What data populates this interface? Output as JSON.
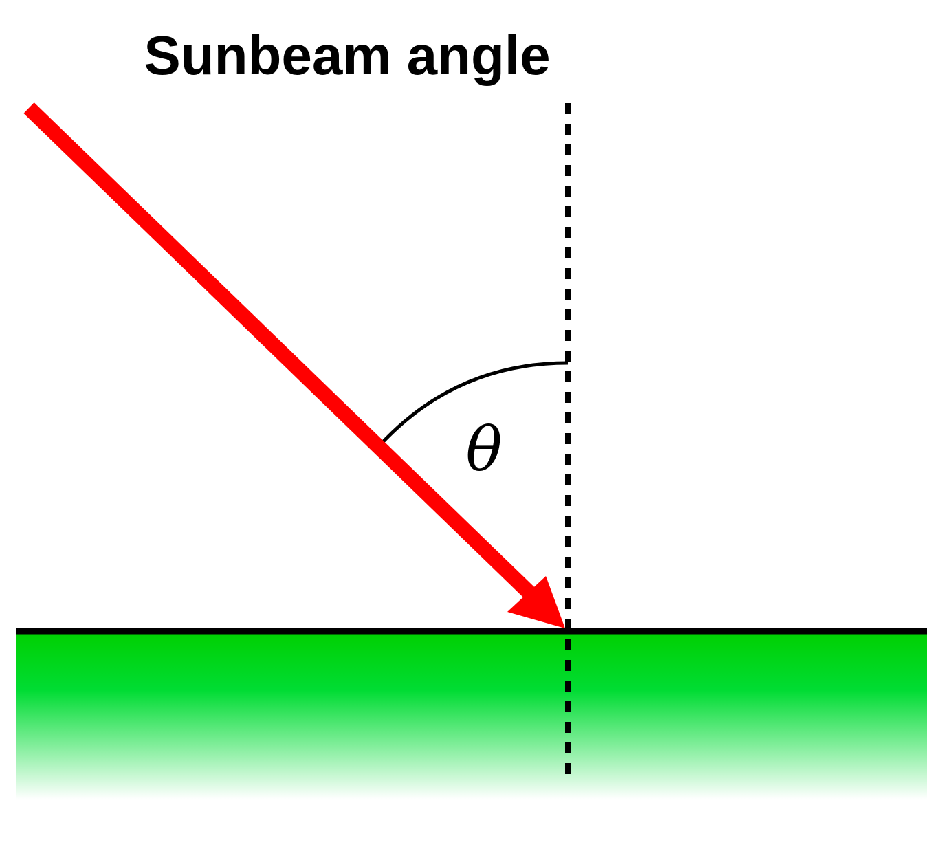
{
  "diagram": {
    "title": "Sunbeam angle",
    "angle_label": "θ",
    "colors": {
      "sunbeam": "#ff0000",
      "ground": "#00d000",
      "ground_fade": "#ffffff",
      "lines": "#000000",
      "background": "#ffffff"
    },
    "icons": {
      "sunbeam": "red-arrow-icon"
    }
  }
}
